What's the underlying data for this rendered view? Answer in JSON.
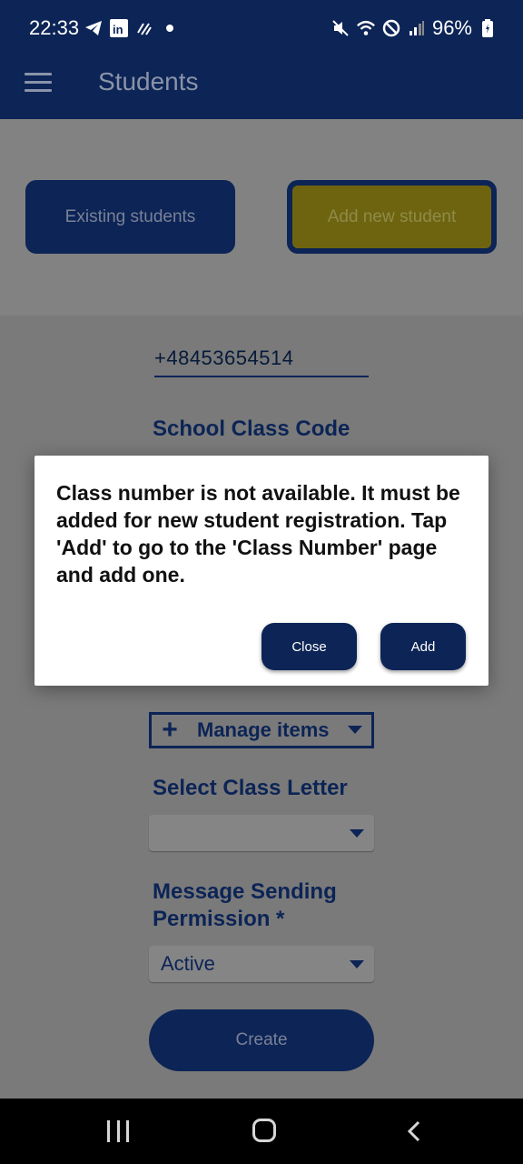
{
  "status_bar": {
    "time": "22:33",
    "battery": "96%",
    "left_icons": [
      "telegram-icon",
      "linkedin-icon",
      "signal-wave-icon",
      "dot-icon"
    ],
    "right_icons": [
      "mute-icon",
      "wifi-icon",
      "do-not-disturb-icon",
      "cell-signal-icon",
      "battery-icon"
    ]
  },
  "app_bar": {
    "title": "Students",
    "menu_icon": "menu-icon"
  },
  "tabs": {
    "existing_label": "Existing students",
    "add_label": "Add new student"
  },
  "form": {
    "phone_value": "+48453654514",
    "school_class_code_label": "School Class Code",
    "manage_items_label": "Manage items",
    "select_class_letter_label": "Select Class Letter",
    "class_letter_value": "",
    "message_permission_label_line1": "Message Sending",
    "message_permission_label_line2": "Permission *",
    "message_permission_value": "Active",
    "create_label": "Create"
  },
  "dialog": {
    "message": "Class number is not available. It must be added for new student registration. Tap 'Add' to go to the 'Class Number' page and add one.",
    "close_label": "Close",
    "add_label": "Add"
  },
  "colors": {
    "primary": "#0c2456",
    "accent": "#e0c400",
    "scrim": "#7a7a7a",
    "dialog_bg": "#ffffff"
  }
}
